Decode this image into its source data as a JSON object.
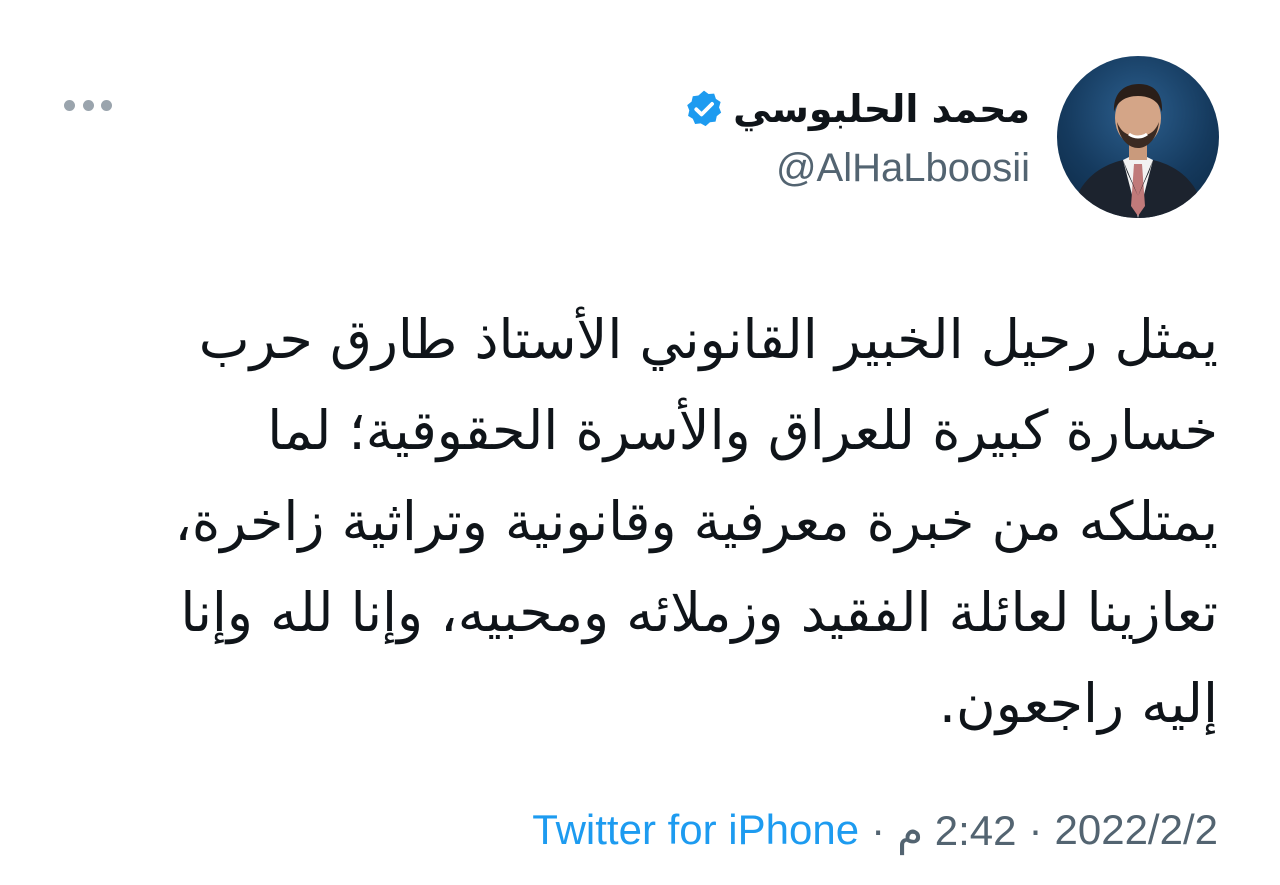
{
  "author": {
    "display_name": "محمد الحلبوسي",
    "handle": "@AlHaLboosii",
    "verified": true,
    "verified_icon": "verified-badge-icon",
    "avatar": "profile-photo"
  },
  "menu": {
    "icon": "more-options-icon"
  },
  "tweet": {
    "lines": [
      "يمثل رحيل الخبير القانوني الأستاذ طارق حرب",
      "خسارة كبيرة للعراق والأسرة الحقوقية؛ لما",
      "يمتلكه من خبرة معرفية وقانونية وتراثية زاخرة،",
      "تعازينا لعائلة الفقيد وزملائه ومحبيه، وإنا لله وإنا",
      "إليه راجعون."
    ]
  },
  "meta": {
    "source": "Twitter for iPhone",
    "separator": "·",
    "time": "2:42 م",
    "date": "2022/2/2"
  },
  "colors": {
    "accent": "#1d9bf0",
    "secondary_text": "#536471",
    "primary_text": "#0f1419"
  }
}
